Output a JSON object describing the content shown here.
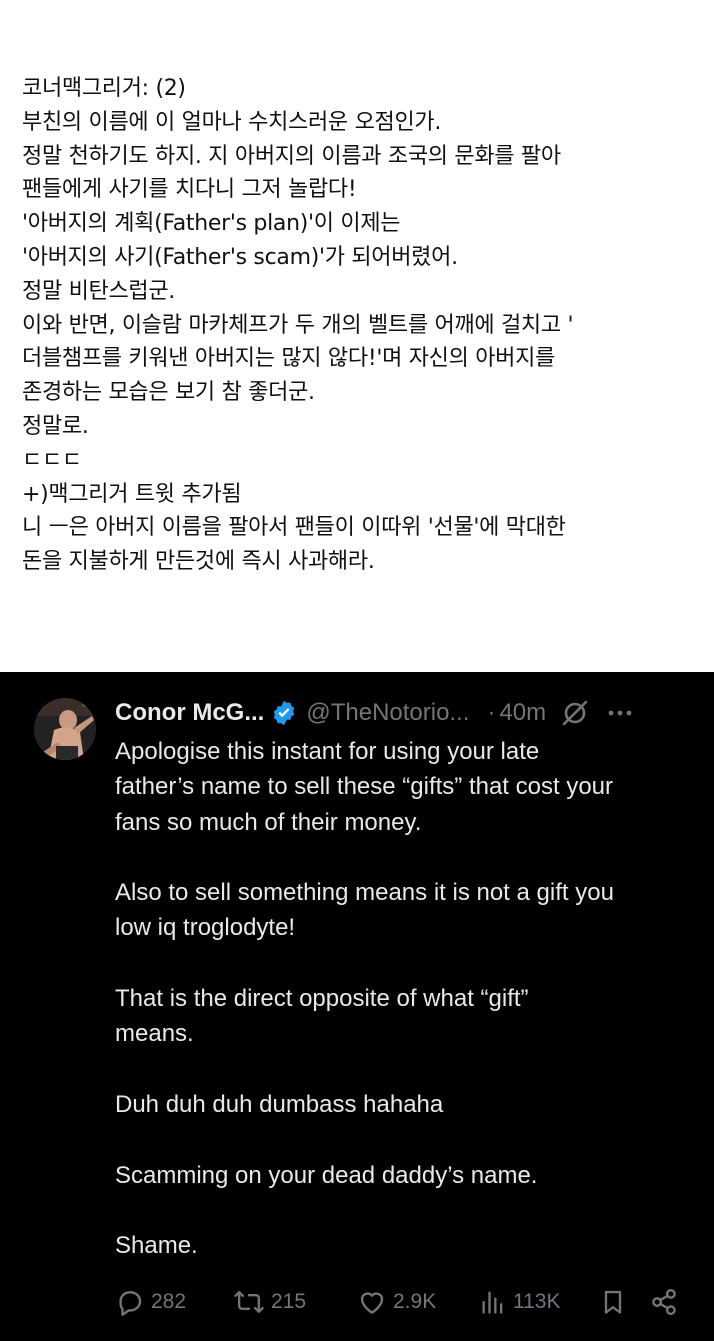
{
  "korean_text": {
    "lines": [
      "코너맥그리거: (2)",
      "부친의 이름에 이 얼마나 수치스러운 오점인가.",
      "정말 천하기도 하지. 지 아버지의 이름과 조국의 문화를 팔아",
      "팬들에게 사기를 치다니 그저 놀랍다!",
      "'아버지의 계획(Father's plan)'이 이제는",
      "'아버지의 사기(Father's scam)'가 되어버렸어.",
      "정말 비탄스럽군.",
      "이와 반면, 이슬람 마카체프가 두 개의 벨트를 어깨에 걸치고 '",
      "더블챔프를 키워낸 아버지는 많지 않다!'며 자신의 아버지를",
      "존경하는 모습은 보기 참 좋더군.",
      "정말로.",
      "ㄷㄷㄷ",
      "+)맥그리거 트윗 추가됨",
      "니 ㅡ은 아버지 이름을 팔아서 팬들이 이따위 '선물'에 막대한",
      "돈을 지불하게 만든것에 즉시 사과해라."
    ]
  },
  "tweet": {
    "display_name": "Conor McG...",
    "handle": "@TheNotorio...",
    "separator": "·",
    "time": "40m",
    "paragraphs": [
      [
        "Apologise this instant for using your late",
        "father’s name to sell these “gifts” that cost your",
        "fans so much of their money."
      ],
      [
        "Also to sell something means it is not a gift you",
        "low iq troglodyte!"
      ],
      [
        "That is the direct opposite of what “gift”",
        "means."
      ],
      [
        "Duh duh duh dumbass hahaha"
      ],
      [
        "Scamming on your dead daddy’s name."
      ],
      [
        "Shame."
      ]
    ],
    "actions": {
      "replies": "282",
      "reposts": "215",
      "likes": "2.9K",
      "views": "113K"
    },
    "icons": [
      "verified-badge-icon",
      "grok-icon",
      "more-icon",
      "reply-icon",
      "repost-icon",
      "like-icon",
      "views-icon",
      "bookmark-icon",
      "share-icon"
    ],
    "colors": {
      "background": "#000000",
      "text": "#e7e9ea",
      "secondary": "#71767b",
      "verified": "#1d9bf0"
    }
  }
}
